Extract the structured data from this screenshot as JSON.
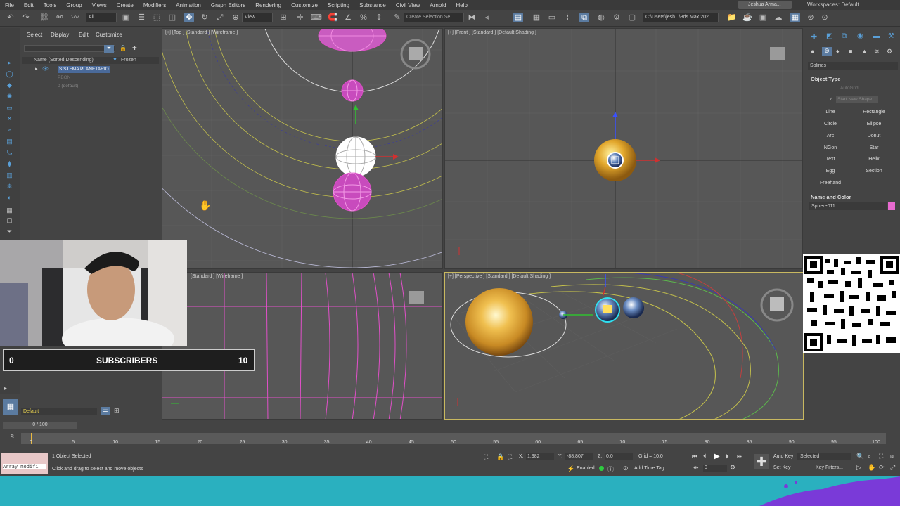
{
  "menubar": {
    "items": [
      "File",
      "Edit",
      "Tools",
      "Group",
      "Views",
      "Create",
      "Modifiers",
      "Animation",
      "Graph Editors",
      "Rendering",
      "Customize",
      "Scripting",
      "Substance",
      "Civil View",
      "Arnold",
      "Help"
    ],
    "user": "Jeshua Arma...",
    "workspaces_label": "Workspaces:",
    "workspaces_value": "Default"
  },
  "toolbar": {
    "filter_value": "All",
    "view_value": "View",
    "selection_set": "Create Selection Se",
    "path": "C:\\Users\\jesh...\\3ds Max 202"
  },
  "scene_explorer": {
    "tabs": [
      "Select",
      "Display",
      "Edit",
      "Customize"
    ],
    "column_name": "Name (Sorted Descending)",
    "column_frozen": "Frozen",
    "rows": [
      "SISTEMA PLANETARIO",
      "PBON",
      "0 (default)"
    ]
  },
  "viewports": {
    "top_label": "[+] [Top ] [Standard ] [Wireframe ]",
    "front_label": "[+] [Front ] [Standard ] [Default Shading ]",
    "left_label": "[Standard ] [Wireframe ]",
    "persp_label": "[+] [Perspective ] [Standard ] [Default Shading ]"
  },
  "command_panel": {
    "category": "Splines",
    "object_type": "Object Type",
    "autogrid": "AutoGrid",
    "start_new_shape": "Start New Shape",
    "buttons": [
      "Line",
      "Rectangle",
      "Circle",
      "Ellipse",
      "Arc",
      "Donut",
      "NGon",
      "Star",
      "Text",
      "Helix",
      "Egg",
      "Section",
      "Freehand"
    ],
    "name_and_color": "Name and Color",
    "object_name": "Sphere011",
    "object_color": "#e86ad0"
  },
  "overlay": {
    "sub_start": "0",
    "sub_label": "SUBSCRIBERS",
    "sub_end": "10"
  },
  "layer": {
    "name": "Default"
  },
  "timeline": {
    "frame_display": "0 / 100",
    "ticks": [
      "0",
      "5",
      "10",
      "15",
      "20",
      "25",
      "30",
      "35",
      "40",
      "45",
      "50",
      "55",
      "60",
      "65",
      "70",
      "75",
      "80",
      "85",
      "90",
      "95",
      "100"
    ]
  },
  "status": {
    "maxscript": "Array modifi",
    "selected": "1 Object Selected",
    "prompt": "Click and drag to select and move objects",
    "x_label": "X:",
    "x_value": "1.982",
    "y_label": "Y:",
    "y_value": "-88.807",
    "z_label": "Z:",
    "z_value": "0.0",
    "grid": "Grid = 10.0",
    "enabled_label": "Enabled:",
    "add_time_tag": "Add Time Tag",
    "auto_key": "Auto Key",
    "set_key": "Set Key",
    "key_mode": "Selected",
    "key_filters": "Key Filters...",
    "frame": "0"
  },
  "colors": {
    "accent": "#5b7ba0",
    "selection_magenta": "#e050c8",
    "teal": "#2ab0bf"
  }
}
